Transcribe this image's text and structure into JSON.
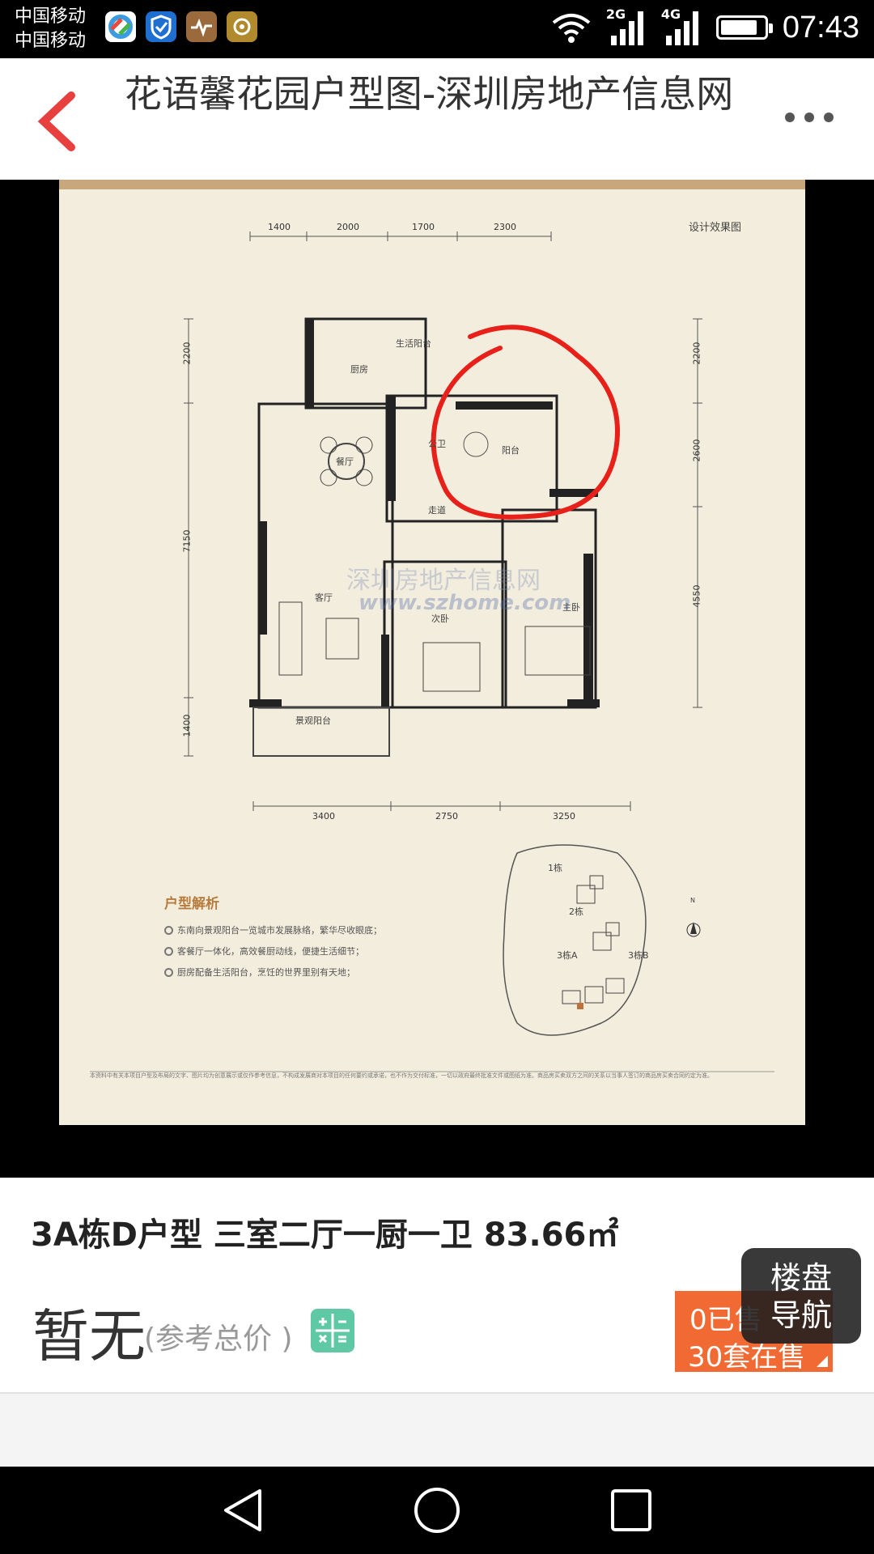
{
  "status_bar": {
    "carrier_line1": "中国移动",
    "carrier_line2": "中国移动",
    "network_1": "2G",
    "network_2": "4G",
    "time": "07:43",
    "battery_level": 0.85
  },
  "header": {
    "title": "花语馨花园户型图-深圳房地产信息网"
  },
  "floor_plan": {
    "tag": "设计效果图",
    "top_dims": [
      "1400",
      "2000",
      "1700",
      "2300"
    ],
    "bottom_dims": [
      "3400",
      "2750",
      "3250"
    ],
    "left_dims": [
      "2200",
      "7150",
      "1400"
    ],
    "right_dims": [
      "2200",
      "2600",
      "4550"
    ],
    "rooms": {
      "kitchen": "厨房",
      "utility_balcony": "生活阳台",
      "dining": "餐厅",
      "public_bath": "公卫",
      "balcony": "阳台",
      "corridor": "走道",
      "living": "客厅",
      "second_bedroom": "次卧",
      "master_bedroom": "主卧",
      "view_balcony": "景观阳台"
    },
    "site": {
      "b1": "1栋",
      "b2": "2栋",
      "b3a": "3栋A",
      "b3b": "3栋B",
      "north": "N"
    },
    "watermark_cn": "深圳房地产信息网",
    "watermark_en": "www.szhome.com",
    "analysis_title": "户型解析",
    "analysis_items": [
      "东南向景观阳台一览城市发展脉络，繁华尽收眼底；",
      "客餐厅一体化，高效餐厨动线，便捷生活细节；",
      "厨房配备生活阳台，烹饪的世界里别有天地；"
    ],
    "disclaimer": "本资料中有关本项目户型及布局的文字、图片均为创意展示或仅作参考信息，不构成发展商对本项目的任何要约或承诺，也不作为交付标准，一切以政府最终批准文件或图纸为准。商品房买卖双方之间的关系以当事人签订的商品房买卖合同约定为准。"
  },
  "listing": {
    "unit_title": "3A栋D户型 三室二厅一厨一卫 83.66㎡",
    "price": "暂无",
    "price_note": "(参考总价 )",
    "sale_line1": "0已售",
    "sale_line2": "30套在售",
    "nav_line1": "楼盘",
    "nav_line2": "导航"
  },
  "colors": {
    "accent_red": "#e8403e",
    "sale_orange": "#f26a33",
    "calc_green": "#5fc9a6",
    "plan_bg": "#f3eddd",
    "plan_band": "#c9a77c"
  }
}
